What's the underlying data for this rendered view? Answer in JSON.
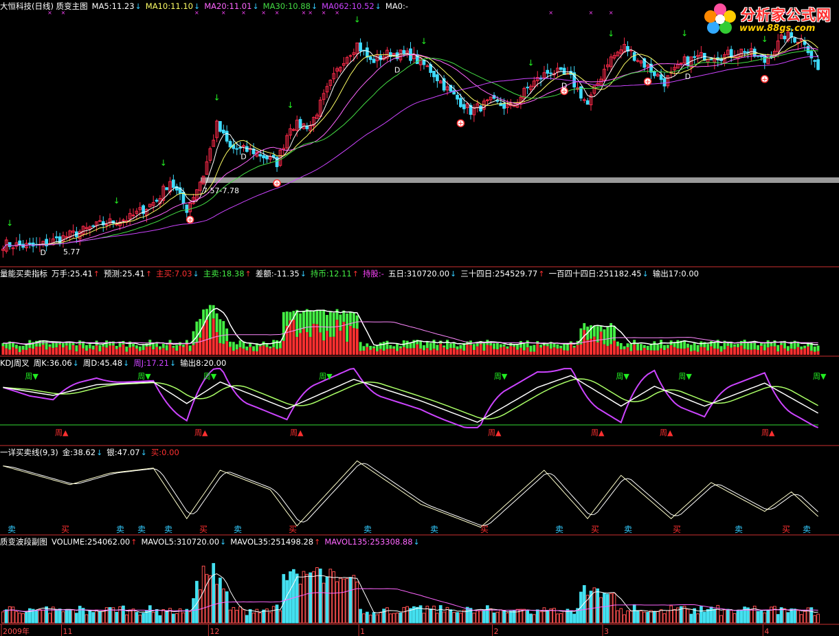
{
  "colors": {
    "up": "#ff2a4a",
    "down": "#3fdcff",
    "ma5": "#ffffff",
    "ma10": "#ffff66",
    "ma20": "#ff66ff",
    "ma30": "#44dd44",
    "ma62": "#cc44ff",
    "volUp": "#ff3030",
    "volDown": "#44ee44",
    "kdjK": "#ffffff",
    "kdjD": "#aaff66",
    "kdjJ": "#cc44ff",
    "axis": "#cc3030",
    "gold": "#ffffcc",
    "silver": "#ffffff",
    "buy": "#ff3030",
    "sell": "#33ccff",
    "highlight_band": "#9a9a9a"
  },
  "panel1": {
    "title": "大恒科技(日线) 质变主图",
    "items": [
      {
        "text": "MA5:11.23",
        "color": "#ffffff",
        "arrow": "↓",
        "arrow_color": "#33ccff"
      },
      {
        "text": "MA10:11.10",
        "color": "#ffff66",
        "arrow": "↓",
        "arrow_color": "#33ccff"
      },
      {
        "text": "MA20:11.01",
        "color": "#ff66ff",
        "arrow": "↓",
        "arrow_color": "#33ccff"
      },
      {
        "text": "MA30:10.88",
        "color": "#44dd44",
        "arrow": "↓",
        "arrow_color": "#33ccff"
      },
      {
        "text": "MA062:10.52",
        "color": "#cc44ff",
        "arrow": "↓",
        "arrow_color": "#33ccff"
      },
      {
        "text": "MA0:-",
        "color": "#ffffff",
        "arrow": "",
        "arrow_color": "#ffffff"
      }
    ],
    "annotation_range": "7.57-7.78",
    "annotation_low": "5.77",
    "d_label": "D"
  },
  "panel2": {
    "title": "量能买卖指标",
    "items": [
      {
        "text": "万手:25.41",
        "color": "#ffffff",
        "arrow": "↑",
        "arrow_color": "#ff3030"
      },
      {
        "text": "预测:25.41",
        "color": "#ffffff",
        "arrow": "↑",
        "arrow_color": "#ff3030"
      },
      {
        "text": "主买:7.03",
        "color": "#ff3030",
        "arrow": "↓",
        "arrow_color": "#33ccff"
      },
      {
        "text": "主卖:18.38",
        "color": "#44ee44",
        "arrow": "↑",
        "arrow_color": "#ff3030"
      },
      {
        "text": "差额:-11.35",
        "color": "#ffffff",
        "arrow": "↓",
        "arrow_color": "#33ccff"
      },
      {
        "text": "持币:12.11",
        "color": "#44ee44",
        "arrow": "↑",
        "arrow_color": "#ff3030"
      },
      {
        "text": "持股:-",
        "color": "#ff44ff",
        "arrow": "",
        "arrow_color": "#ffffff"
      },
      {
        "text": "五日:310720.00",
        "color": "#ffffff",
        "arrow": "↓",
        "arrow_color": "#33ccff"
      },
      {
        "text": "三十四日:254529.77",
        "color": "#ffffff",
        "arrow": "↑",
        "arrow_color": "#ff3030"
      },
      {
        "text": "一百四十四日:251182.45",
        "color": "#ffffff",
        "arrow": "↓",
        "arrow_color": "#33ccff"
      },
      {
        "text": "输出17:0.00",
        "color": "#ffffff",
        "arrow": "",
        "arrow_color": "#ffffff"
      }
    ]
  },
  "panel3": {
    "title": "KDJ周叉",
    "items": [
      {
        "text": "周K:36.06",
        "color": "#ffffff",
        "arrow": "↓",
        "arrow_color": "#33ccff"
      },
      {
        "text": "周D:45.48",
        "color": "#ffffff",
        "arrow": "↓",
        "arrow_color": "#33ccff"
      },
      {
        "text": "周J:17.21",
        "color": "#cc44ff",
        "arrow": "↓",
        "arrow_color": "#33ccff"
      },
      {
        "text": "输出8:20.00",
        "color": "#ffffff",
        "arrow": "",
        "arrow_color": "#ffffff"
      }
    ],
    "top_label": "周▼",
    "bottom_label": "周▲"
  },
  "panel4": {
    "title": "一详买卖线(9,3)",
    "items": [
      {
        "text": "金:38.62",
        "color": "#ffffff",
        "arrow": "↓",
        "arrow_color": "#33ccff"
      },
      {
        "text": "银:47.07",
        "color": "#ffffff",
        "arrow": "↓",
        "arrow_color": "#33ccff"
      },
      {
        "text": "买:0.00",
        "color": "#ff3030",
        "arrow": "",
        "arrow_color": "#ffffff"
      }
    ],
    "buy_label": "买",
    "sell_label": "卖"
  },
  "panel5": {
    "title": "质变波段副图",
    "items": [
      {
        "text": "VOLUME:254062.00",
        "color": "#ffffff",
        "arrow": "↑",
        "arrow_color": "#ff3030"
      },
      {
        "text": "MAVOL5:310720.00",
        "color": "#ffffff",
        "arrow": "↓",
        "arrow_color": "#33ccff"
      },
      {
        "text": "MAVOL35:251498.28",
        "color": "#ffffff",
        "arrow": "↑",
        "arrow_color": "#ff3030"
      },
      {
        "text": "MAVOL135:253308.88",
        "color": "#ff66ff",
        "arrow": "↓",
        "arrow_color": "#33ccff"
      }
    ]
  },
  "x_axis": {
    "labels": [
      {
        "text": "2009年",
        "i": 0
      },
      {
        "text": "11",
        "i": 18
      },
      {
        "text": "12",
        "i": 62
      },
      {
        "text": "1",
        "i": 107
      },
      {
        "text": "2",
        "i": 147
      },
      {
        "text": "3",
        "i": 180
      },
      {
        "text": "4",
        "i": 228
      }
    ]
  },
  "watermark": {
    "title": "分析家公式网",
    "url": "www.88gs.com"
  },
  "chart_data": [
    {
      "type": "candlestick",
      "title": "大恒科技(日线) 质变主图",
      "n_bars": 245,
      "price_range": [
        5.5,
        14.0
      ],
      "close_anchors": [
        [
          0,
          6.1
        ],
        [
          10,
          6.0
        ],
        [
          20,
          6.4
        ],
        [
          30,
          6.8
        ],
        [
          38,
          7.0
        ],
        [
          46,
          7.6
        ],
        [
          50,
          8.3
        ],
        [
          55,
          7.3
        ],
        [
          60,
          8.5
        ],
        [
          64,
          10.2
        ],
        [
          68,
          9.4
        ],
        [
          75,
          9.3
        ],
        [
          82,
          8.9
        ],
        [
          86,
          10.2
        ],
        [
          92,
          10.2
        ],
        [
          97,
          11.4
        ],
        [
          102,
          12.5
        ],
        [
          106,
          13.0
        ],
        [
          110,
          12.4
        ],
        [
          116,
          12.7
        ],
        [
          122,
          12.6
        ],
        [
          128,
          12.1
        ],
        [
          134,
          11.3
        ],
        [
          140,
          10.7
        ],
        [
          146,
          11.0
        ],
        [
          152,
          10.8
        ],
        [
          158,
          11.6
        ],
        [
          164,
          12.1
        ],
        [
          170,
          11.8
        ],
        [
          175,
          10.9
        ],
        [
          181,
          12.4
        ],
        [
          186,
          12.9
        ],
        [
          192,
          12.3
        ],
        [
          198,
          11.7
        ],
        [
          204,
          12.4
        ],
        [
          210,
          12.6
        ],
        [
          216,
          12.6
        ],
        [
          222,
          12.8
        ],
        [
          228,
          12.4
        ],
        [
          234,
          13.3
        ],
        [
          240,
          13.1
        ],
        [
          244,
          12.1
        ]
      ],
      "ma_labels": [
        "MA5:11.23",
        "MA10:11.10",
        "MA20:11.01",
        "MA30:10.88",
        "MA062:10.52",
        "MA0:-"
      ],
      "annotations": [
        "7.57-7.78",
        "5.77"
      ]
    },
    {
      "type": "bar",
      "title": "量能买卖指标",
      "series_labels": [
        "万手:25.41",
        "预测:25.41",
        "主买:7.03",
        "主卖:18.38",
        "差额:-11.35",
        "持币:12.11",
        "持股:-",
        "五日:310720.00",
        "三十四日:254529.77",
        "一百四十四日:251182.45",
        "输出17:0.00"
      ]
    },
    {
      "type": "line",
      "title": "KDJ周叉",
      "series_labels": [
        "周K:36.06",
        "周D:45.48",
        "周J:17.21",
        "输出8:20.00"
      ],
      "k_anchors": [
        [
          0,
          70
        ],
        [
          15,
          55
        ],
        [
          28,
          75
        ],
        [
          45,
          80
        ],
        [
          55,
          40
        ],
        [
          65,
          80
        ],
        [
          85,
          30
        ],
        [
          105,
          85
        ],
        [
          125,
          45
        ],
        [
          142,
          5
        ],
        [
          160,
          70
        ],
        [
          170,
          92
        ],
        [
          185,
          35
        ],
        [
          195,
          72
        ],
        [
          210,
          35
        ],
        [
          228,
          78
        ],
        [
          244,
          22
        ]
      ]
    },
    {
      "type": "line",
      "title": "一详买卖线(9,3)",
      "series_labels": [
        "金:38.62",
        "银:47.07",
        "买:0.00"
      ],
      "gold_anchors": [
        [
          0,
          88
        ],
        [
          20,
          62
        ],
        [
          32,
          78
        ],
        [
          45,
          85
        ],
        [
          55,
          15
        ],
        [
          65,
          82
        ],
        [
          80,
          55
        ],
        [
          88,
          5
        ],
        [
          106,
          95
        ],
        [
          125,
          35
        ],
        [
          143,
          3
        ],
        [
          162,
          82
        ],
        [
          175,
          15
        ],
        [
          185,
          75
        ],
        [
          200,
          15
        ],
        [
          212,
          65
        ],
        [
          228,
          25
        ],
        [
          236,
          52
        ],
        [
          244,
          18
        ]
      ]
    },
    {
      "type": "bar",
      "title": "质变波段副图",
      "series_labels": [
        "VOLUME:254062.00",
        "MAVOL5:310720.00",
        "MAVOL35:251498.28",
        "MAVOL135:253308.88"
      ]
    }
  ]
}
